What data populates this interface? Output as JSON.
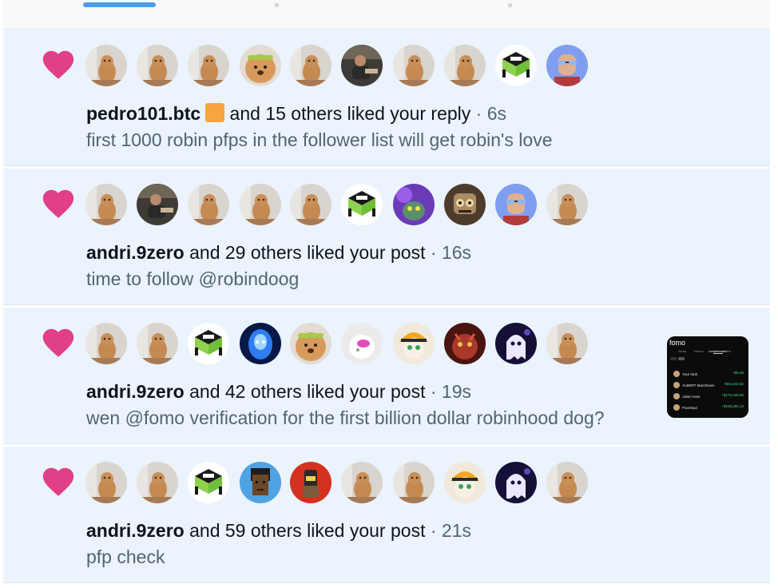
{
  "colors": {
    "accent": "#4b9ce8",
    "heart": "#e23f8a",
    "bg": "#ebf3fc"
  },
  "thumbnail": {
    "brand": "fomo",
    "tabs": [
      "Alerts",
      "Tokens",
      "Leaderboard",
      "Feed"
    ],
    "rows": [
      {
        "name": "Your rank",
        "value": "+$0.25"
      },
      {
        "name": "ALBERT Marchivam",
        "value": "+$34,632.62"
      },
      {
        "name": "Adam Ham",
        "value": "+$175,049.66"
      },
      {
        "name": "PoorStud",
        "value": "+$238,286.12"
      }
    ]
  },
  "notifications": [
    {
      "user": "pedro101.btc",
      "badge": true,
      "rest": " and 15 others liked your reply",
      "time": " · 6s",
      "text": "first 1000 robin pfps in the follower list will get robin's love",
      "avatars": [
        "dog-avatar",
        "dog-avatar",
        "dog-avatar",
        "fluffy-dog-avatar",
        "dog-avatar",
        "person-avatar",
        "dog-avatar",
        "dog-avatar",
        "green-logo-avatar",
        "bald-man-avatar"
      ]
    },
    {
      "user": "andri.9zero",
      "badge": false,
      "rest": " and 29 others liked your post",
      "time": " · 16s",
      "text": "time to follow @robindoog",
      "avatars": [
        "dog-avatar",
        "person-avatar",
        "dog-avatar",
        "dog-avatar",
        "dog-avatar",
        "green-logo-avatar",
        "purple-monster-avatar",
        "robot-avatar",
        "bald-man-avatar",
        "dog-avatar"
      ]
    },
    {
      "user": "andri.9zero",
      "badge": false,
      "rest": " and 42 others liked your post",
      "time": " · 19s",
      "text": "wen @fomo verification for the first billion dollar robinhood dog?",
      "avatars": [
        "dog-avatar",
        "dog-avatar",
        "green-logo-avatar",
        "blue-alien-avatar",
        "fluffy-dog-avatar",
        "white-creature-avatar",
        "anime-girl-avatar",
        "red-creature-avatar",
        "ghost-avatar",
        "dog-avatar"
      ],
      "thumbnail": true
    },
    {
      "user": "andri.9zero",
      "badge": false,
      "rest": " and 59 others liked your post",
      "time": " · 21s",
      "text": "pfp check",
      "avatars": [
        "dog-avatar",
        "dog-avatar",
        "green-logo-avatar",
        "punk-avatar",
        "red-bird-avatar",
        "dog-avatar",
        "dog-avatar",
        "anime-girl-avatar",
        "ghost-avatar",
        "dog-avatar"
      ]
    }
  ]
}
